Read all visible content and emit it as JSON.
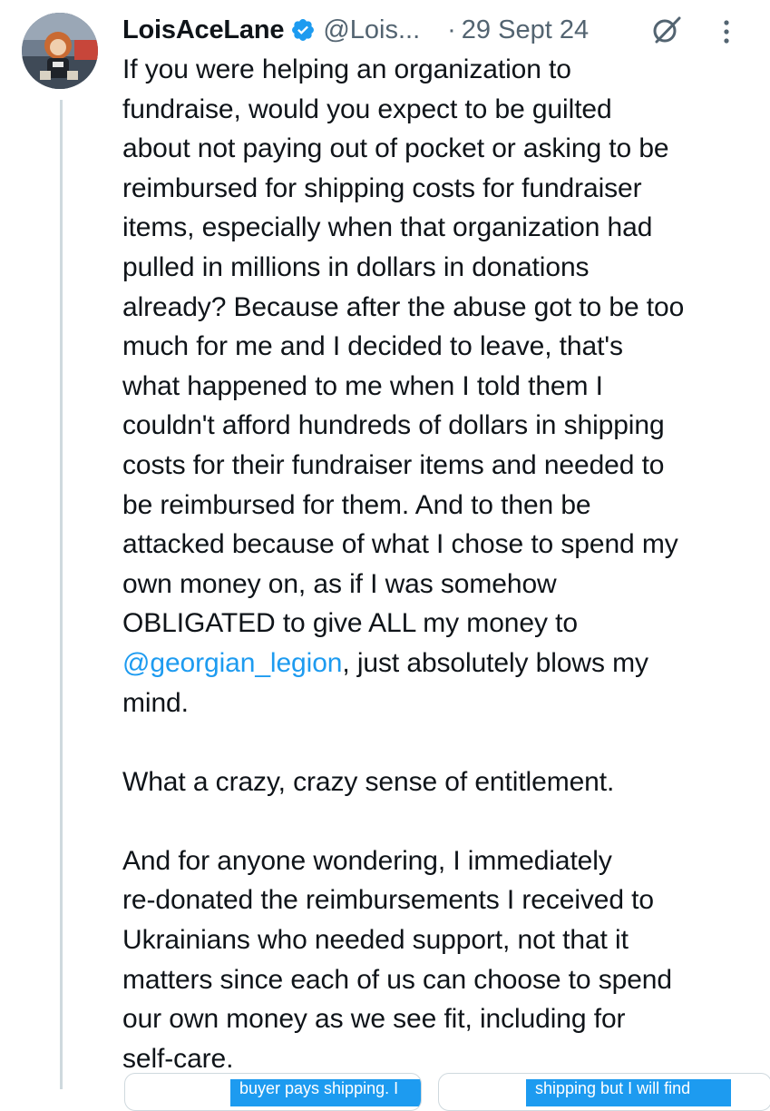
{
  "tweet": {
    "display_name": "LoisAceLane",
    "handle": "@Lois...",
    "separator": "·",
    "date": "29 Sept 24",
    "text_part1": "If you were helping an organization to\nfundraise, would you expect to be guilted\nabout not paying out of pocket or asking to be\nreimbursed for shipping costs for fundraiser\nitems, especially when that organization had\npulled in millions in dollars in donations\nalready? Because after the abuse got to be too\nmuch for me and I decided to leave, that's\nwhat happened to me when I told them I\ncouldn't afford hundreds of dollars in shipping\ncosts for their fundraiser items and needed to\nbe reimbursed for them. And to then be\nattacked because of what I chose to spend my\nown money on, as if I was somehow\nOBLIGATED to give ALL my money to\n",
    "mention": "@georgian_legion",
    "text_part2": ", just absolutely blows my\nmind.\n\nWhat a crazy, crazy sense of entitlement.\n\nAnd for anyone wondering, I immediately\nre-donated the reimbursements I received to\nUkrainians who needed support, not that it\nmatters since each of us can choose to spend\nour own money as we see fit, including for\nself-care."
  },
  "attachments": [
    {
      "caption": "buyer pays shipping. I"
    },
    {
      "caption": "shipping but I will find"
    }
  ],
  "icons": {
    "verified": "verified-badge-icon",
    "grok": "grok-icon",
    "more": "more-options-icon"
  },
  "colors": {
    "text": "#0f1419",
    "secondary": "#536471",
    "link": "#1d9bf0",
    "verified": "#1d9bf0",
    "thread_line": "#cfd9de"
  }
}
